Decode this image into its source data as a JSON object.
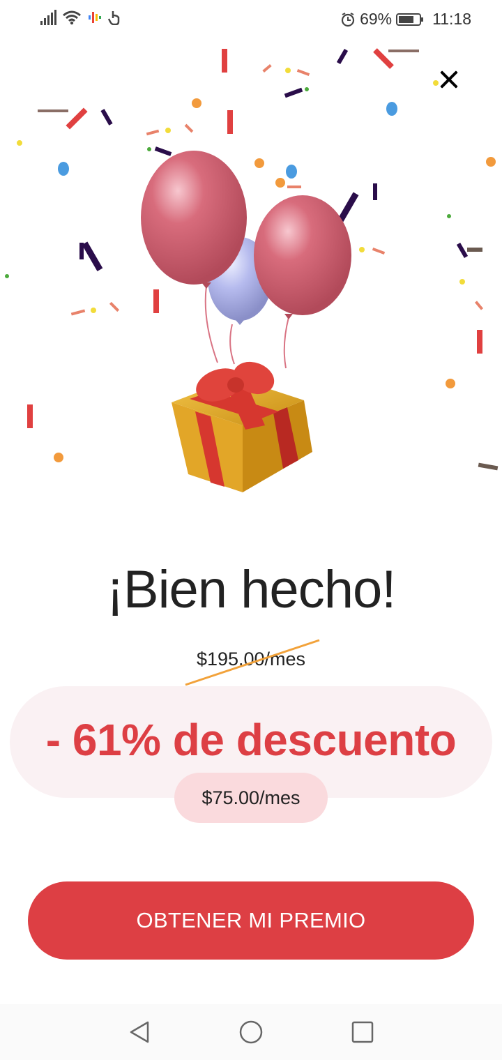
{
  "status_bar": {
    "battery": "69%",
    "time": "11:18"
  },
  "offer": {
    "title": "¡Bien hecho!",
    "old_price": "$195.00/mes",
    "discount": "- 61% de descuento",
    "new_price": "$75.00/mes",
    "cta_label": "OBTENER MI PREMIO"
  },
  "icons": {
    "close": "close-icon",
    "back": "back-icon",
    "home": "home-icon",
    "recents": "recents-icon"
  },
  "colors": {
    "accent": "#dd3f44",
    "pill_bg": "#faf1f3",
    "price_pill_bg": "#fadadd",
    "strike": "#f2a23a"
  }
}
